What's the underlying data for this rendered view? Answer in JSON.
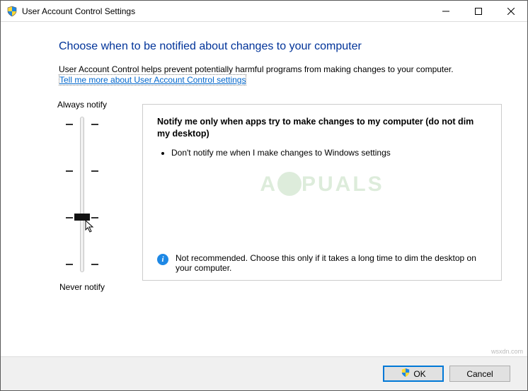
{
  "window": {
    "title": "User Account Control Settings"
  },
  "heading": "Choose when to be notified about changes to your computer",
  "description": "User Account Control helps prevent potentially harmful programs from making changes to your computer.",
  "help_link": "Tell me more about User Account Control settings",
  "slider": {
    "top_label": "Always notify",
    "bottom_label": "Never notify",
    "levels": 4,
    "current_level": 1
  },
  "level_info": {
    "title": "Notify me only when apps try to make changes to my computer (do not dim my desktop)",
    "bullets": [
      "Don't notify me when I make changes to Windows settings"
    ],
    "note": "Not recommended. Choose this only if it takes a long time to dim the desktop on your computer."
  },
  "buttons": {
    "ok": "OK",
    "cancel": "Cancel"
  },
  "watermark": "A  PUALS",
  "attribution": "wsxdn.com"
}
